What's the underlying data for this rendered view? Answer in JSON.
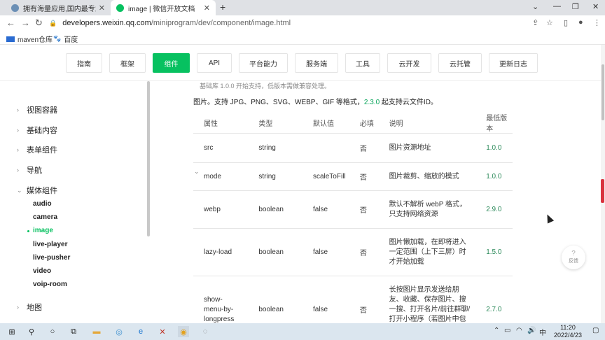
{
  "browser": {
    "tabs": [
      {
        "title": "拥有海量应用,国内最专业的手机",
        "active": false
      },
      {
        "title": "image | 微信开放文档",
        "active": true
      }
    ],
    "new_tab": "+",
    "url_host": "developers.weixin.qq.com",
    "url_path": "/miniprogram/dev/component/image.html",
    "bookmarks": [
      {
        "label": "maven仓库",
        "icon": "maven-icon"
      },
      {
        "label": "百度",
        "icon": "baidu-paw-icon"
      }
    ]
  },
  "site_nav": {
    "items": [
      "指南",
      "框架",
      "组件",
      "API",
      "平台能力",
      "服务端",
      "工具",
      "云开发",
      "云托管",
      "更新日志"
    ],
    "active": "组件"
  },
  "sidebar": {
    "groups": [
      {
        "label": "视图容器",
        "expanded": false
      },
      {
        "label": "基础内容",
        "expanded": false
      },
      {
        "label": "表单组件",
        "expanded": false
      },
      {
        "label": "导航",
        "expanded": false
      },
      {
        "label": "媒体组件",
        "expanded": true
      },
      {
        "label": "地图",
        "expanded": false
      }
    ],
    "media_items": [
      "audio",
      "camera",
      "image",
      "live-player",
      "live-pusher",
      "video",
      "voip-room"
    ],
    "active_item": "image"
  },
  "content": {
    "note_top": "基础库 1.0.0 开始支持，低版本需做兼容处理。",
    "desc_prefix": "图片。支持 JPG、PNG、SVG、WEBP、GIF 等格式，",
    "desc_version": "2.3.0",
    "desc_suffix": " 起支持云文件ID。",
    "table_headers": [
      "属性",
      "类型",
      "默认值",
      "必填",
      "说明",
      "最低版本"
    ],
    "rows": [
      {
        "attr": "src",
        "type": "string",
        "default": "",
        "required": "否",
        "desc": "图片资源地址",
        "min_version": "1.0.0"
      },
      {
        "attr": "mode",
        "type": "string",
        "default": "scaleToFill",
        "required": "否",
        "desc": "图片裁剪、缩放的模式",
        "min_version": "1.0.0"
      },
      {
        "attr": "webp",
        "type": "boolean",
        "default": "false",
        "required": "否",
        "desc": "默认不解析 webP 格式，只支持网络资源",
        "min_version": "2.9.0"
      },
      {
        "attr": "lazy-load",
        "type": "boolean",
        "default": "false",
        "required": "否",
        "desc": "图片懒加载，在即将进入一定范围（上下三屏）时才开始加载",
        "min_version": "1.5.0"
      },
      {
        "attr": "show-menu-by-longpress",
        "type": "boolean",
        "default": "false",
        "required": "否",
        "desc": "长按图片显示发送给朋友、收藏、保存图片、搜一搜、打开名片/前往群聊/打开小程序（若图片中包含对应二维",
        "min_version": "2.7.0"
      }
    ]
  },
  "feedback": {
    "icon": "?",
    "label": "反馈"
  },
  "taskbar": {
    "time": "11:20",
    "date": "2022/4/23",
    "tray_text": "中"
  },
  "colors": {
    "accent": "#07c160",
    "version_green": "#2b8a5a"
  }
}
